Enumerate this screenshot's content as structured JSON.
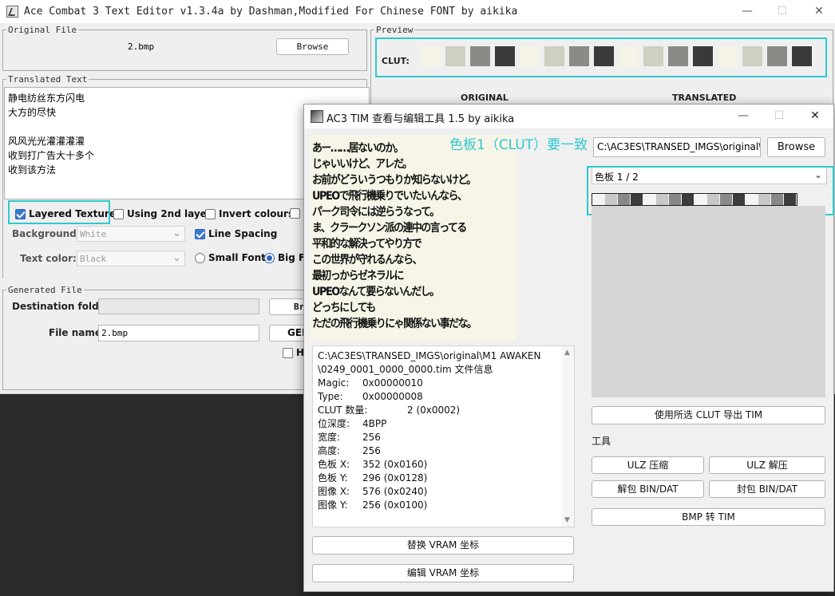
{
  "main_window": {
    "title": "Ace Combat 3 Text Editor v1.3.4a by Dashman,Modified For Chinese FONT by aikika",
    "original_file": {
      "legend": "Original File",
      "filename": "2.bmp",
      "browse_label": "Browse"
    },
    "translated_text": {
      "legend": "Translated Text",
      "lines": [
        "静电纺丝东方闪电",
        "大方的尽快",
        "",
        "风风光光灌灌灌灌",
        "收到打广告大十多个",
        "收到该方法"
      ]
    },
    "options": {
      "layered_texture": "Layered Texture",
      "using_2nd_layer": "Using 2nd layer",
      "invert_colours": "Invert colours",
      "background_label": "Background:",
      "background_value": "White",
      "line_spacing": "Line Spacing",
      "text_color_label": "Text color:",
      "text_color_value": "Black",
      "small_font": "Small Font",
      "big_font": "Big Fo"
    },
    "generated_file": {
      "legend": "Generated File",
      "destination_label": "Destination folder:",
      "destination_value": "",
      "browse_label": "Br",
      "file_name_label": "File name:",
      "file_name_value": "2.bmp",
      "generate_label": "GEN",
      "extra_check": "Ha"
    },
    "preview": {
      "legend": "Preview",
      "clut_label": "CLUT:",
      "original_label": "ORIGINAL",
      "translated_label": "TRANSLATED"
    }
  },
  "clut_colors": [
    "#f4f3e6",
    "#cfcfc2",
    "#8a8a86",
    "#3a3a3a",
    "#f4f3e6",
    "#cfcfc2",
    "#8a8a86",
    "#3a3a3a",
    "#f4f3e6",
    "#cfcfc2",
    "#8a8a86",
    "#3a3a3a",
    "#f4f3e6",
    "#cfcfc2",
    "#8a8a86",
    "#3a3a3a"
  ],
  "tim_window": {
    "title": "AC3 TIM 查看与编辑工具 1.5 by aikika",
    "annotation": "色板1（CLUT）要一致",
    "japanese_lines": [
      "あー……居ないのか。",
      "じゃいいけど、アレだ。",
      "お前がどういうつもりか知らないけど。",
      "UPEOで飛行機乗りでいたいんなら、",
      "パーク司令には逆らうなって。",
      "ま、クラークソン派の連中の言ってる",
      "平和的な解決ってやり方で",
      "この世界が守れるんなら、",
      "最初っからゼネラルに",
      "UPEOなんて要らないんだし。",
      "どっちにしても",
      "ただの飛行機乗りにゃ関係ない事だな。"
    ],
    "info": {
      "path_line1": "C:\\AC3ES\\TRANSED_IMGS\\original\\M1 AWAKEN",
      "path_line2": "\\0249_0001_0000_0000.tim 文件信息",
      "rows": [
        {
          "k": "Magic:",
          "v": "0x00000010"
        },
        {
          "k": "Type:",
          "v": "0x00000008"
        },
        {
          "k": "CLUT 数量:",
          "v": "2 (0x0002)"
        },
        {
          "k": "位深度:",
          "v": "4BPP"
        },
        {
          "k": "宽度:",
          "v": "256"
        },
        {
          "k": "高度:",
          "v": "256"
        },
        {
          "k": "色板 X:",
          "v": "352 (0x0160)"
        },
        {
          "k": "色板 Y:",
          "v": "296 (0x0128)"
        },
        {
          "k": "图像 X:",
          "v": "576 (0x0240)"
        },
        {
          "k": "图像 Y:",
          "v": "256 (0x0100)"
        }
      ]
    },
    "path_value": "C:\\AC3ES\\TRANSED_IMGS\\original\\",
    "browse_label": "Browse",
    "clut_select": "色板 1 / 2",
    "export_label": "使用所选 CLUT 导出 TIM",
    "tools_label": "工具",
    "ulz_compress": "ULZ 压缩",
    "ulz_decompress": "ULZ 解压",
    "unpack_bin": "解包 BIN/DAT",
    "pack_bin": "封包 BIN/DAT",
    "bmp_to_tim": "BMP 转 TIM",
    "replace_vram": "替换 VRAM 坐标",
    "edit_vram": "编辑 VRAM 坐标"
  },
  "tim_clut_colors": [
    "#f4f4f4",
    "#c8c8c8",
    "#888888",
    "#3c3c3c",
    "#f4f4f4",
    "#c8c8c8",
    "#888888",
    "#3c3c3c",
    "#f4f4f4",
    "#c8c8c8",
    "#888888",
    "#3c3c3c",
    "#f4f4f4",
    "#c8c8c8",
    "#888888",
    "#3c3c3c"
  ],
  "highlight_color": "#2ec9cf"
}
